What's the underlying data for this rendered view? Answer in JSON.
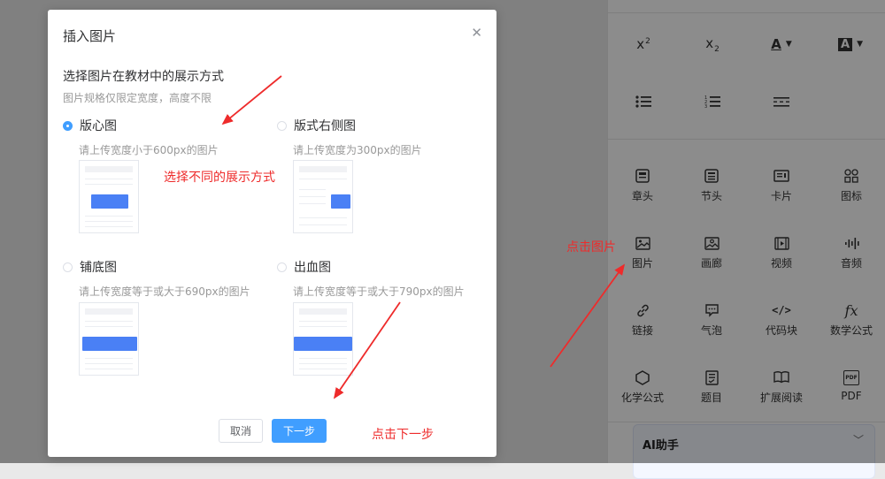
{
  "dialog": {
    "title": "插入图片",
    "close_icon": "close-icon",
    "question": "选择图片在教材中的展示方式",
    "hint": "图片规格仅限定宽度，高度不限",
    "options": [
      {
        "label": "版心图",
        "desc": "请上传宽度小于600px的图片",
        "selected": true
      },
      {
        "label": "版式右侧图",
        "desc": "请上传宽度为300px的图片",
        "selected": false
      },
      {
        "label": "铺底图",
        "desc": "请上传宽度等于或大于690px的图片",
        "selected": false
      },
      {
        "label": "出血图",
        "desc": "请上传宽度等于或大于790px的图片",
        "selected": false
      }
    ],
    "cancel_label": "取消",
    "next_label": "下一步",
    "accent_color": "#409eff"
  },
  "panel": {
    "format_row1": [
      {
        "icon": "superscript-icon",
        "text": "x",
        "mark": "2"
      },
      {
        "icon": "subscript-icon",
        "text": "x",
        "mark": "2"
      },
      {
        "icon": "font-color-icon",
        "text": "A"
      },
      {
        "icon": "highlight-color-icon",
        "text": "A"
      }
    ],
    "format_row2": [
      {
        "icon": "bullet-list-icon"
      },
      {
        "icon": "numbered-list-icon"
      },
      {
        "icon": "divider-line-icon"
      }
    ],
    "tools": [
      {
        "label": "章头",
        "icon": "chapter-head-icon"
      },
      {
        "label": "节头",
        "icon": "section-head-icon"
      },
      {
        "label": "卡片",
        "icon": "card-icon"
      },
      {
        "label": "图标",
        "icon": "grid-icon"
      },
      {
        "label": "图片",
        "icon": "image-icon"
      },
      {
        "label": "画廊",
        "icon": "gallery-icon"
      },
      {
        "label": "视频",
        "icon": "video-icon"
      },
      {
        "label": "音频",
        "icon": "audio-icon"
      },
      {
        "label": "链接",
        "icon": "link-icon"
      },
      {
        "label": "气泡",
        "icon": "bubble-icon"
      },
      {
        "label": "代码块",
        "icon": "code-icon",
        "glyph": "</>"
      },
      {
        "label": "数学公式",
        "icon": "formula-icon",
        "glyph": "fx"
      },
      {
        "label": "化学公式",
        "icon": "hexagon-icon"
      },
      {
        "label": "题目",
        "icon": "question-icon"
      },
      {
        "label": "扩展阅读",
        "icon": "book-icon"
      },
      {
        "label": "PDF",
        "icon": "pdf-icon",
        "glyph": "PDF"
      }
    ],
    "ai_assistant": "AI助手"
  },
  "annotations": {
    "choose_mode": "选择不同的展示方式",
    "click_image": "点击图片",
    "click_next": "点击下一步",
    "color": "#ee2b2b"
  }
}
